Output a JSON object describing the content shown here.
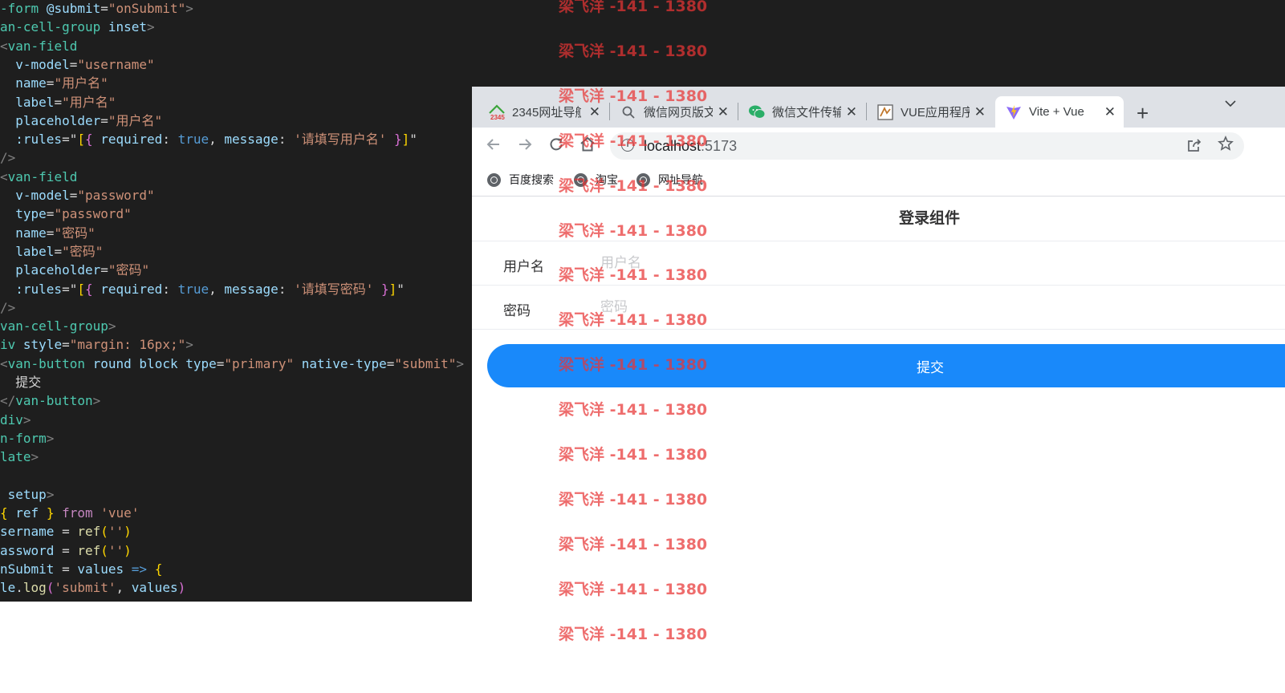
{
  "editor": {
    "lines": [
      [
        [
          "t-tag",
          "-form"
        ],
        [
          "t-plain",
          " "
        ],
        [
          "t-attr",
          "@submit"
        ],
        [
          "t-plain",
          "="
        ],
        [
          "t-str",
          "\"onSubmit\""
        ],
        [
          "t-punc",
          ">"
        ]
      ],
      [
        [
          "t-tag",
          "an-cell-group"
        ],
        [
          "t-plain",
          " "
        ],
        [
          "t-attr",
          "inset"
        ],
        [
          "t-punc",
          ">"
        ]
      ],
      [
        [
          "t-punc",
          "<"
        ],
        [
          "t-tag",
          "van-field"
        ]
      ],
      [
        [
          "t-plain",
          "  "
        ],
        [
          "t-attr",
          "v-model"
        ],
        [
          "t-plain",
          "="
        ],
        [
          "t-str",
          "\"username\""
        ]
      ],
      [
        [
          "t-plain",
          "  "
        ],
        [
          "t-attr",
          "name"
        ],
        [
          "t-plain",
          "="
        ],
        [
          "t-str",
          "\"用户名\""
        ]
      ],
      [
        [
          "t-plain",
          "  "
        ],
        [
          "t-attr",
          "label"
        ],
        [
          "t-plain",
          "="
        ],
        [
          "t-str",
          "\"用户名\""
        ]
      ],
      [
        [
          "t-plain",
          "  "
        ],
        [
          "t-attr",
          "placeholder"
        ],
        [
          "t-plain",
          "="
        ],
        [
          "t-str",
          "\"用户名\""
        ]
      ],
      [
        [
          "t-plain",
          "  "
        ],
        [
          "t-attr",
          ":rules"
        ],
        [
          "t-plain",
          "=\""
        ],
        [
          "t-brace",
          "["
        ],
        [
          "t-brace2",
          "{"
        ],
        [
          "t-plain",
          " "
        ],
        [
          "t-attr",
          "required"
        ],
        [
          "t-plain",
          ": "
        ],
        [
          "t-kw",
          "true"
        ],
        [
          "t-plain",
          ", "
        ],
        [
          "t-attr",
          "message"
        ],
        [
          "t-plain",
          ": "
        ],
        [
          "t-str",
          "'请填写用户名'"
        ],
        [
          "t-plain",
          " "
        ],
        [
          "t-brace2",
          "}"
        ],
        [
          "t-brace",
          "]"
        ],
        [
          "t-plain",
          "\""
        ]
      ],
      [
        [
          "t-punc",
          "/>"
        ]
      ],
      [
        [
          "t-punc",
          "<"
        ],
        [
          "t-tag",
          "van-field"
        ]
      ],
      [
        [
          "t-plain",
          "  "
        ],
        [
          "t-attr",
          "v-model"
        ],
        [
          "t-plain",
          "="
        ],
        [
          "t-str",
          "\"password\""
        ]
      ],
      [
        [
          "t-plain",
          "  "
        ],
        [
          "t-attr",
          "type"
        ],
        [
          "t-plain",
          "="
        ],
        [
          "t-str",
          "\"password\""
        ]
      ],
      [
        [
          "t-plain",
          "  "
        ],
        [
          "t-attr",
          "name"
        ],
        [
          "t-plain",
          "="
        ],
        [
          "t-str",
          "\"密码\""
        ]
      ],
      [
        [
          "t-plain",
          "  "
        ],
        [
          "t-attr",
          "label"
        ],
        [
          "t-plain",
          "="
        ],
        [
          "t-str",
          "\"密码\""
        ]
      ],
      [
        [
          "t-plain",
          "  "
        ],
        [
          "t-attr",
          "placeholder"
        ],
        [
          "t-plain",
          "="
        ],
        [
          "t-str",
          "\"密码\""
        ]
      ],
      [
        [
          "t-plain",
          "  "
        ],
        [
          "t-attr",
          ":rules"
        ],
        [
          "t-plain",
          "=\""
        ],
        [
          "t-brace",
          "["
        ],
        [
          "t-brace2",
          "{"
        ],
        [
          "t-plain",
          " "
        ],
        [
          "t-attr",
          "required"
        ],
        [
          "t-plain",
          ": "
        ],
        [
          "t-kw",
          "true"
        ],
        [
          "t-plain",
          ", "
        ],
        [
          "t-attr",
          "message"
        ],
        [
          "t-plain",
          ": "
        ],
        [
          "t-str",
          "'请填写密码'"
        ],
        [
          "t-plain",
          " "
        ],
        [
          "t-brace2",
          "}"
        ],
        [
          "t-brace",
          "]"
        ],
        [
          "t-plain",
          "\""
        ]
      ],
      [
        [
          "t-punc",
          "/>"
        ]
      ],
      [
        [
          "t-tag",
          "van-cell-group"
        ],
        [
          "t-punc",
          ">"
        ]
      ],
      [
        [
          "t-tag",
          "iv"
        ],
        [
          "t-plain",
          " "
        ],
        [
          "t-attr",
          "style"
        ],
        [
          "t-plain",
          "="
        ],
        [
          "t-str",
          "\"margin: 16px;\""
        ],
        [
          "t-punc",
          ">"
        ]
      ],
      [
        [
          "t-punc",
          "<"
        ],
        [
          "t-tag",
          "van-button"
        ],
        [
          "t-plain",
          " "
        ],
        [
          "t-attr",
          "round"
        ],
        [
          "t-plain",
          " "
        ],
        [
          "t-attr",
          "block"
        ],
        [
          "t-plain",
          " "
        ],
        [
          "t-attr",
          "type"
        ],
        [
          "t-plain",
          "="
        ],
        [
          "t-str",
          "\"primary\""
        ],
        [
          "t-plain",
          " "
        ],
        [
          "t-attr",
          "native-type"
        ],
        [
          "t-plain",
          "="
        ],
        [
          "t-str",
          "\"submit\""
        ],
        [
          "t-punc",
          ">"
        ]
      ],
      [
        [
          "t-text",
          "  提交"
        ]
      ],
      [
        [
          "t-punc",
          "</"
        ],
        [
          "t-tag",
          "van-button"
        ],
        [
          "t-punc",
          ">"
        ]
      ],
      [
        [
          "t-tag",
          "div"
        ],
        [
          "t-punc",
          ">"
        ]
      ],
      [
        [
          "t-tag",
          "n-form"
        ],
        [
          "t-punc",
          ">"
        ]
      ],
      [
        [
          "t-tag",
          "late"
        ],
        [
          "t-punc",
          ">"
        ]
      ],
      [
        [
          "t-plain",
          ""
        ]
      ],
      [
        [
          "t-plain",
          " "
        ],
        [
          "t-attr",
          "setup"
        ],
        [
          "t-punc",
          ">"
        ]
      ],
      [
        [
          "t-brace",
          "{"
        ],
        [
          "t-plain",
          " "
        ],
        [
          "t-var",
          "ref"
        ],
        [
          "t-plain",
          " "
        ],
        [
          "t-brace",
          "}"
        ],
        [
          "t-plain",
          " "
        ],
        [
          "t-kw2",
          "from"
        ],
        [
          "t-plain",
          " "
        ],
        [
          "t-str",
          "'vue'"
        ]
      ],
      [
        [
          "t-var",
          "sername"
        ],
        [
          "t-plain",
          " = "
        ],
        [
          "t-fn",
          "ref"
        ],
        [
          "t-brace",
          "("
        ],
        [
          "t-str",
          "''"
        ],
        [
          "t-brace",
          ")"
        ]
      ],
      [
        [
          "t-var",
          "assword"
        ],
        [
          "t-plain",
          " = "
        ],
        [
          "t-fn",
          "ref"
        ],
        [
          "t-brace",
          "("
        ],
        [
          "t-str",
          "''"
        ],
        [
          "t-brace",
          ")"
        ]
      ],
      [
        [
          "t-var",
          "nSubmit"
        ],
        [
          "t-plain",
          " = "
        ],
        [
          "t-var",
          "values"
        ],
        [
          "t-plain",
          " "
        ],
        [
          "t-kw",
          "=>"
        ],
        [
          "t-plain",
          " "
        ],
        [
          "t-brace",
          "{"
        ]
      ],
      [
        [
          "t-var",
          "le"
        ],
        [
          "t-plain",
          "."
        ],
        [
          "t-fn",
          "log"
        ],
        [
          "t-brace2",
          "("
        ],
        [
          "t-str",
          "'submit'"
        ],
        [
          "t-plain",
          ", "
        ],
        [
          "t-var",
          "values"
        ],
        [
          "t-brace2",
          ")"
        ]
      ]
    ]
  },
  "browser": {
    "tabs": [
      {
        "title": "2345网址导航",
        "icon": "2345-icon",
        "active": false
      },
      {
        "title": "微信网页版文件传输",
        "icon": "search-icon",
        "active": false
      },
      {
        "title": "微信文件传输助手",
        "icon": "wechat-icon",
        "active": false
      },
      {
        "title": "VUE应用程序",
        "icon": "vue-app-icon",
        "active": false
      },
      {
        "title": "Vite + Vue",
        "icon": "vite-icon",
        "active": true
      }
    ],
    "tab_close": "✕",
    "new_tab": "+",
    "url_host": "localhost",
    "url_port": ":5173",
    "bookmarks": [
      "百度搜索",
      "淘宝",
      "网址导航"
    ]
  },
  "page": {
    "title": "登录组件",
    "username_label": "用户名",
    "username_placeholder": "用户名",
    "password_label": "密码",
    "password_placeholder": "密码",
    "submit_label": "提交"
  },
  "watermark": {
    "text": "梁飞洋 -141 - 1380",
    "color": "#e83434"
  },
  "colors": {
    "primary": "#1989fa",
    "editor_bg": "#1e1e1e"
  }
}
